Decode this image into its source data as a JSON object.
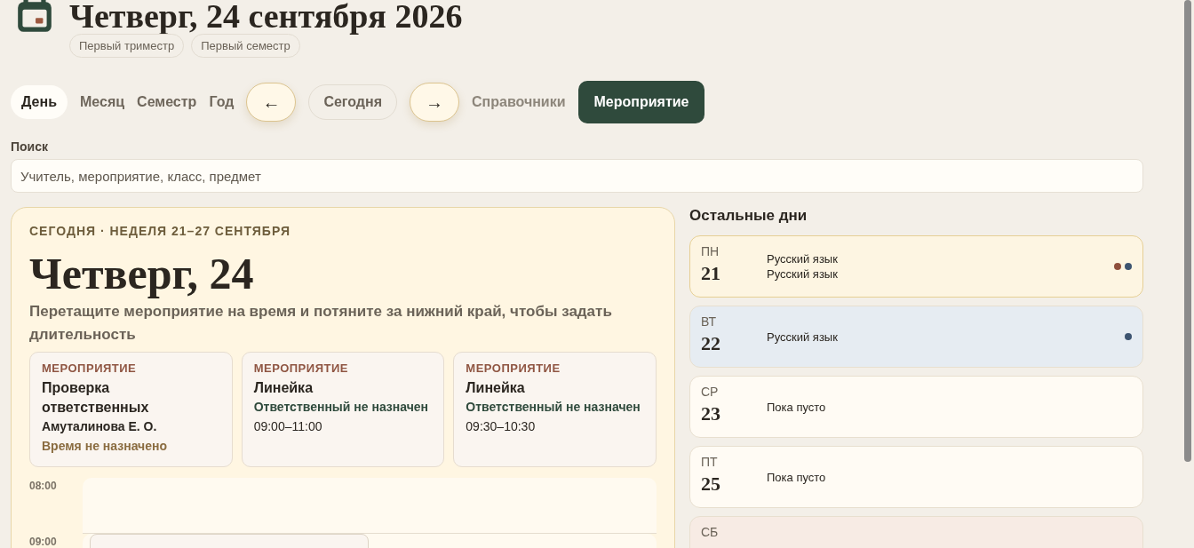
{
  "header": {
    "title": "Четверг, 24 сентября 2026",
    "chips": [
      "Первый триместр",
      "Первый семестр"
    ]
  },
  "view_tabs": [
    {
      "label": "День",
      "selected": true
    },
    {
      "label": "Месяц",
      "selected": false
    },
    {
      "label": "Семестр",
      "selected": false
    },
    {
      "label": "Год",
      "selected": false
    }
  ],
  "nav": {
    "prev": "←",
    "today": "Сегодня",
    "next": "→"
  },
  "links": [
    "Справочники"
  ],
  "primary_button": "Мероприятие",
  "search": {
    "label": "Поиск",
    "placeholder": "Учитель, мероприятие, класс, предмет"
  },
  "today_panel": {
    "eyebrow": "СЕГОДНЯ · НЕДЕЛЯ 21–27 СЕНТЯБРЯ",
    "title": "Четверг, 24",
    "hint": "Перетащите мероприятие на время и потяните за нижний край, чтобы задать длительность",
    "events": [
      {
        "kind_label": "МЕРОПРИЯТИЕ",
        "title": "Проверка ответственных",
        "responsible": "Амуталинова Е. О.",
        "responsible_assigned": true,
        "time": "Время не назначено",
        "time_set": false
      },
      {
        "kind_label": "МЕРОПРИЯТИЕ",
        "title": "Линейка",
        "responsible": "Ответственный не назначен",
        "responsible_assigned": false,
        "time": "09:00–11:00",
        "time_set": true
      },
      {
        "kind_label": "МЕРОПРИЯТИЕ",
        "title": "Линейка",
        "responsible": "Ответственный не назначен",
        "responsible_assigned": false,
        "time": "09:30–10:30",
        "time_set": true
      }
    ],
    "hours": [
      "08:00",
      "09:00"
    ]
  },
  "other_days": {
    "title": "Остальные дни",
    "days": [
      {
        "weekday": "ПН",
        "date": "21",
        "color": "#fdf5e2",
        "items": [
          "Русский язык",
          "Русский язык"
        ],
        "dots": [
          {
            "color": "#8f4f3c"
          },
          {
            "color": "#3d5470"
          }
        ]
      },
      {
        "weekday": "ВТ",
        "date": "22",
        "color": "#e6ecf2",
        "items": [
          "Русский язык"
        ],
        "dots": [
          {
            "color": "#3d5470"
          }
        ]
      },
      {
        "weekday": "СР",
        "date": "23",
        "color": "#fffbf4",
        "items": [
          "Пока пусто"
        ]
      },
      {
        "weekday": "ПТ",
        "date": "25",
        "color": "#fffbf4",
        "items": [
          "Пока пусто"
        ]
      },
      {
        "weekday": "СБ",
        "color": "#f7ebe4"
      }
    ]
  }
}
